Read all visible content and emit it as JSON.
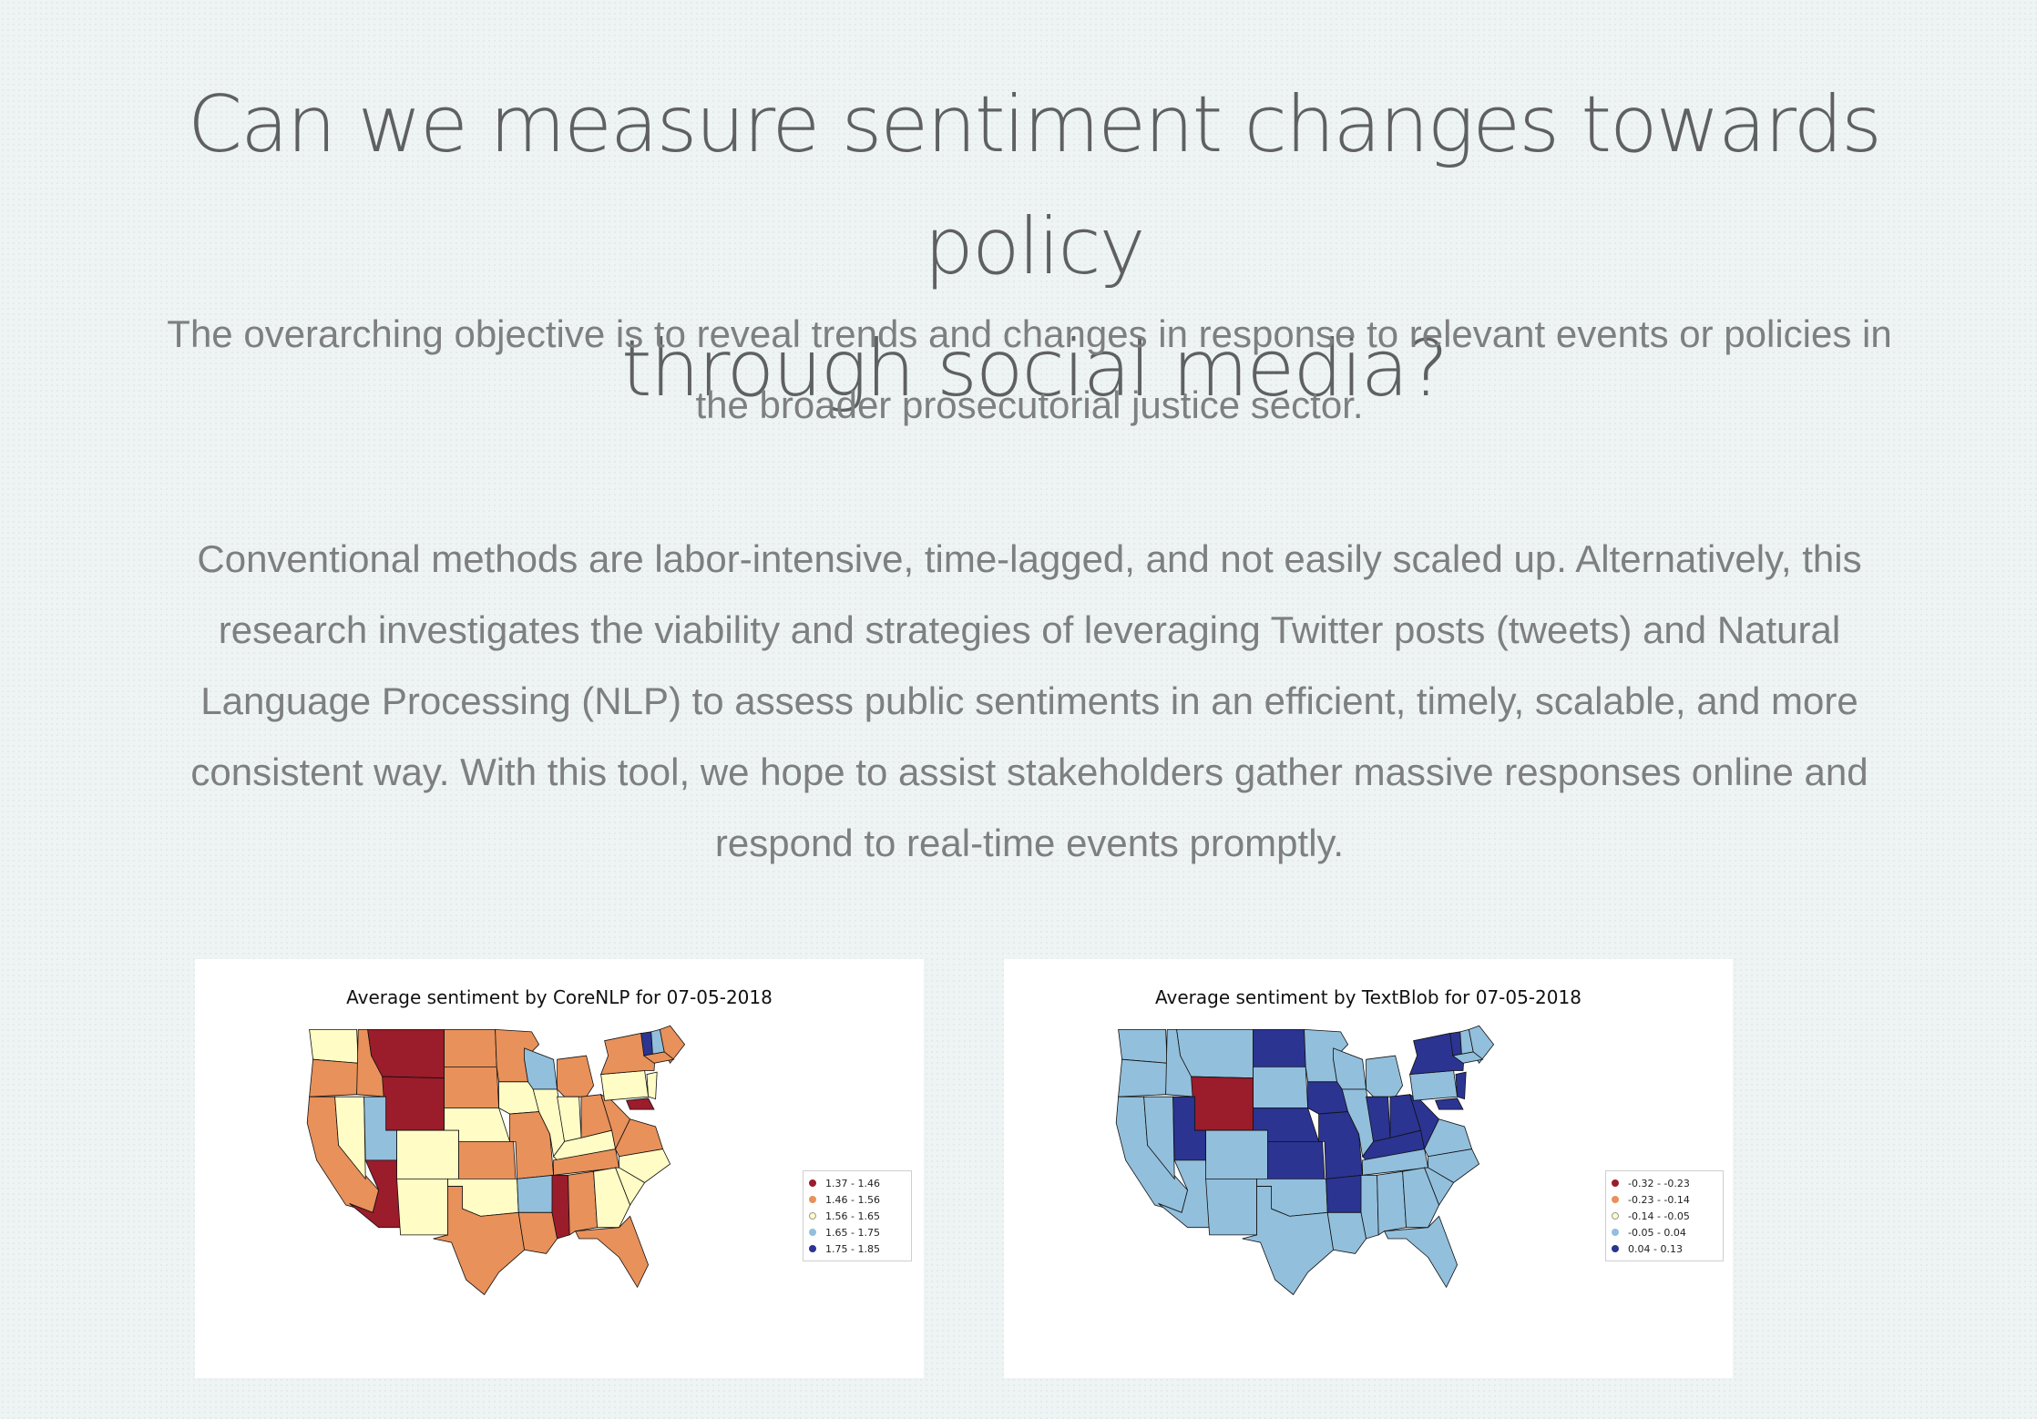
{
  "hero": {
    "title_line1": "Can we measure sentiment changes towards policy",
    "title_line2": "through social media?"
  },
  "intro": {
    "paragraph1": "The overarching objective is to reveal trends and changes in response to relevant events or policies in the broader prosecutorial justice sector.",
    "paragraph2": "Conventional methods are labor-intensive, time-lagged, and not easily scaled up. Alternatively, this research investigates the viability and strategies of leveraging Twitter posts (tweets) and Natural Language Processing (NLP) to assess public sentiments in an efficient, timely, scalable, and more consistent way. With this tool, we hope to assist stakeholders gather massive responses online and respond to real-time events promptly."
  },
  "figures": [
    {
      "title": "Average sentiment by CoreNLP for 07-05-2018",
      "legend": [
        {
          "label": "1.37 - 1.46",
          "color": "#9b1c2a"
        },
        {
          "label": "1.46 - 1.56",
          "color": "#e8915a"
        },
        {
          "label": "1.56 - 1.65",
          "color": "#fffdc5"
        },
        {
          "label": "1.65 - 1.75",
          "color": "#92bfdc"
        },
        {
          "label": "1.75 - 1.85",
          "color": "#2b3491"
        }
      ]
    },
    {
      "title": "Average sentiment by TextBlob for 07-05-2018",
      "legend": [
        {
          "label": "-0.32 - -0.23",
          "color": "#9b1c2a"
        },
        {
          "label": "-0.23 - -0.14",
          "color": "#e8915a"
        },
        {
          "label": "-0.14 - -0.05",
          "color": "#fffdc5"
        },
        {
          "label": "-0.05 - 0.04",
          "color": "#92bfdc"
        },
        {
          "label": "0.04 - 0.13",
          "color": "#2b3491"
        }
      ]
    }
  ],
  "maps": {
    "corenlp": {
      "WA": "#fffdc5",
      "OR": "#e8915a",
      "CA": "#e8915a",
      "ID": "#e8915a",
      "NV": "#fffdc5",
      "MT": "#9b1c2a",
      "WY": "#9b1c2a",
      "UT": "#92bfdc",
      "AZ": "#9b1c2a",
      "CO": "#fffdc5",
      "NM": "#fffdc5",
      "ND": "#e8915a",
      "SD": "#e8915a",
      "NE": "#fffdc5",
      "KS": "#e8915a",
      "OK": "#fffdc5",
      "TX": "#e8915a",
      "MN": "#e8915a",
      "IA": "#fffdc5",
      "MO": "#e8915a",
      "AR": "#92bfdc",
      "LA": "#e8915a",
      "WI": "#92bfdc",
      "IL": "#fffdc5",
      "MS": "#9b1c2a",
      "MI": "#e8915a",
      "IN": "#fffdc5",
      "KY": "#fffdc5",
      "TN": "#e8915a",
      "AL": "#e8915a",
      "OH": "#e8915a",
      "GA": "#fffdc5",
      "FL": "#e8915a",
      "WV": "#e8915a",
      "VA": "#e8915a",
      "NC": "#fffdc5",
      "SC": "#fffdc5",
      "PA": "#fffdc5",
      "NY": "#e8915a",
      "VT": "#2b3491",
      "NH": "#92bfdc",
      "ME": "#e8915a",
      "MA": "#e8915a",
      "NJ": "#fffdc5",
      "MD": "#9b1c2a"
    },
    "textblob": {
      "WA": "#92bfdc",
      "OR": "#92bfdc",
      "CA": "#92bfdc",
      "ID": "#92bfdc",
      "NV": "#92bfdc",
      "MT": "#92bfdc",
      "WY": "#9b1c2a",
      "UT": "#2b3491",
      "AZ": "#92bfdc",
      "CO": "#92bfdc",
      "NM": "#92bfdc",
      "ND": "#2b3491",
      "SD": "#92bfdc",
      "NE": "#2b3491",
      "KS": "#2b3491",
      "OK": "#92bfdc",
      "TX": "#92bfdc",
      "MN": "#92bfdc",
      "IA": "#2b3491",
      "MO": "#2b3491",
      "AR": "#2b3491",
      "LA": "#92bfdc",
      "WI": "#92bfdc",
      "IL": "#92bfdc",
      "MS": "#92bfdc",
      "MI": "#92bfdc",
      "IN": "#2b3491",
      "KY": "#2b3491",
      "TN": "#92bfdc",
      "AL": "#92bfdc",
      "OH": "#2b3491",
      "GA": "#92bfdc",
      "FL": "#92bfdc",
      "WV": "#2b3491",
      "VA": "#92bfdc",
      "NC": "#92bfdc",
      "SC": "#92bfdc",
      "PA": "#92bfdc",
      "NY": "#2b3491",
      "VT": "#2b3491",
      "NH": "#92bfdc",
      "ME": "#92bfdc",
      "MA": "#92bfdc",
      "NJ": "#2b3491",
      "MD": "#2b3491"
    }
  }
}
